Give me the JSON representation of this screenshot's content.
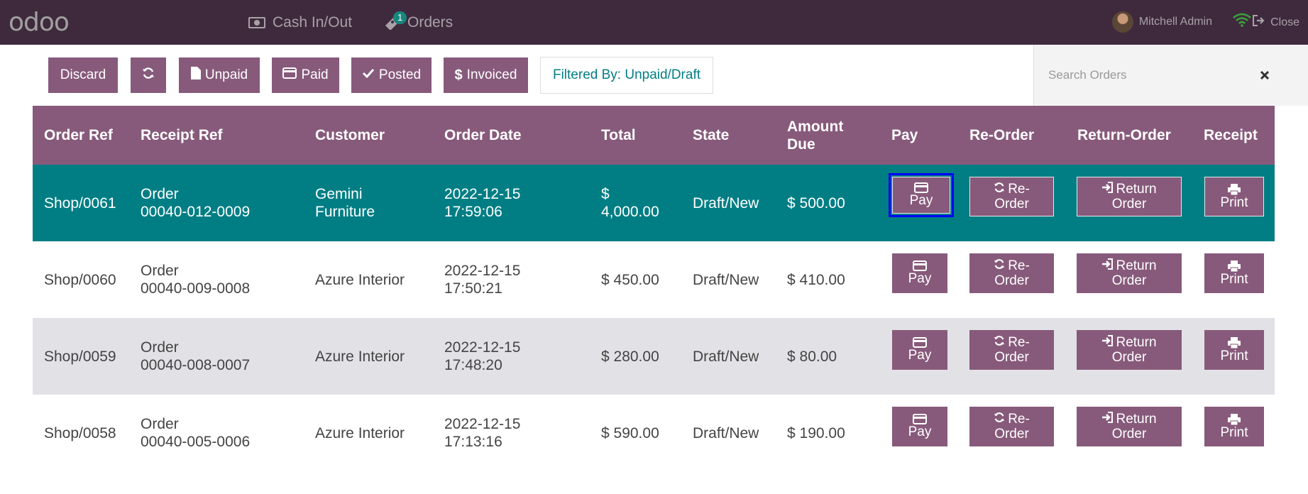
{
  "topbar": {
    "logo": "odoo",
    "cash_label": "Cash In/Out",
    "orders_label": "Orders",
    "orders_badge": "1",
    "user_name": "Mitchell Admin",
    "close_label": "Close"
  },
  "controls": {
    "discard": "Discard",
    "unpaid": "Unpaid",
    "paid": "Paid",
    "posted": "Posted",
    "invoiced": "Invoiced",
    "filter": "Filtered By: Unpaid/Draft",
    "search_placeholder": "Search Orders"
  },
  "columns": [
    "Order Ref",
    "Receipt Ref",
    "Customer",
    "Order Date",
    "Total",
    "State",
    "Amount Due",
    "Pay",
    "Re-Order",
    "Return-Order",
    "Receipt"
  ],
  "button_labels": {
    "pay": "Pay",
    "reorder_1": "Re-",
    "reorder_2": "Order",
    "return_1": "Return",
    "return_2": "Order",
    "print": "Print"
  },
  "rows": [
    {
      "order_ref": "Shop/0061",
      "receipt_1": "Order",
      "receipt_2": "00040-012-0009",
      "customer_1": "Gemini",
      "customer_2": "Furniture",
      "date_1": "2022-12-15",
      "date_2": "17:59:06",
      "total_1": "$",
      "total_2": "4,000.00",
      "state": "Draft/New",
      "due": "$ 500.00"
    },
    {
      "order_ref": "Shop/0060",
      "receipt_1": "Order",
      "receipt_2": "00040-009-0008",
      "customer_1": "Azure Interior",
      "customer_2": "",
      "date_1": "2022-12-15",
      "date_2": "17:50:21",
      "total_1": "$ 450.00",
      "total_2": "",
      "state": "Draft/New",
      "due": "$ 410.00"
    },
    {
      "order_ref": "Shop/0059",
      "receipt_1": "Order",
      "receipt_2": "00040-008-0007",
      "customer_1": "Azure Interior",
      "customer_2": "",
      "date_1": "2022-12-15",
      "date_2": "17:48:20",
      "total_1": "$ 280.00",
      "total_2": "",
      "state": "Draft/New",
      "due": "$ 80.00"
    },
    {
      "order_ref": "Shop/0058",
      "receipt_1": "Order",
      "receipt_2": "00040-005-0006",
      "customer_1": "Azure Interior",
      "customer_2": "",
      "date_1": "2022-12-15",
      "date_2": "17:13:16",
      "total_1": "$ 590.00",
      "total_2": "",
      "state": "Draft/New",
      "due": "$ 190.00"
    }
  ],
  "colors": {
    "topbar": "#3f2a3d",
    "primary": "#875a7b",
    "selected_row": "#017e84",
    "grey_row": "#e2e2e6",
    "focus": "#0000ff"
  }
}
